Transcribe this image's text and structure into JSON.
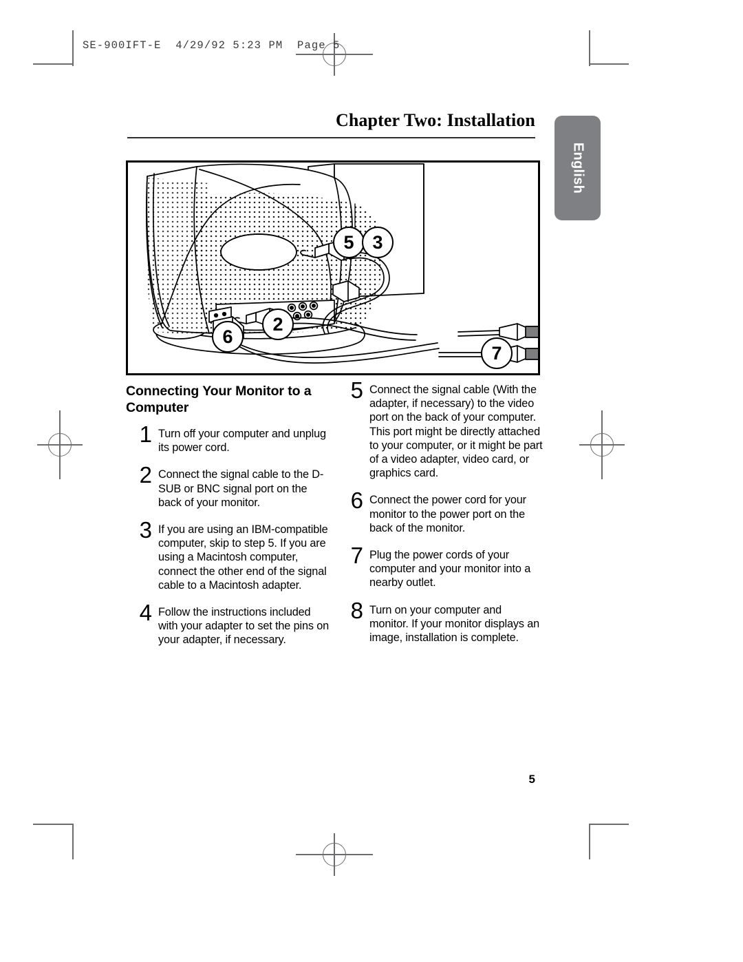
{
  "slug": {
    "text": "SE-900IFT-E  4/29/92 5:23 PM  Page 5"
  },
  "header": {
    "chapter_title": "Chapter Two: Installation",
    "language_tab": "English"
  },
  "figure": {
    "caption_alt": "Rear view of CRT monitor with signal and power cables connected",
    "callouts": [
      {
        "label": "5"
      },
      {
        "label": "3"
      },
      {
        "label": "2"
      },
      {
        "label": "6"
      },
      {
        "label": "7"
      }
    ]
  },
  "content": {
    "section_heading": "Connecting Your Monitor to a Computer",
    "steps_left": [
      {
        "num": "1",
        "text": "Turn off your computer and unplug its power cord."
      },
      {
        "num": "2",
        "text": "Connect the signal cable to the D-SUB or BNC signal port on the back of your monitor."
      },
      {
        "num": "3",
        "text": "If you are using an IBM-compatible computer, skip to step 5. If you are using a Macintosh computer, connect the other end of the signal cable to a Macintosh adapter."
      },
      {
        "num": "4",
        "text": "Follow the instructions included with your adapter to set the pins on your adapter, if necessary."
      }
    ],
    "steps_right": [
      {
        "num": "5",
        "text": "Connect the signal cable (With the adapter, if necessary) to the video port on the back of your computer. This port might be directly attached to your computer, or it might be part of a video adapter, video card, or graphics card."
      },
      {
        "num": "6",
        "text": "Connect the power cord for your monitor to the power port on the back of the monitor."
      },
      {
        "num": "7",
        "text": "Plug the power cords of your computer and your monitor into a nearby outlet."
      },
      {
        "num": "8",
        "text": "Turn on your computer and monitor. If your monitor displays an image, installation is complete."
      }
    ]
  },
  "footer": {
    "page_number": "5"
  },
  "colors": {
    "tab_gray": "#7f8083",
    "rule": "#2e2e30",
    "crop_mark": "#6b6b70"
  }
}
